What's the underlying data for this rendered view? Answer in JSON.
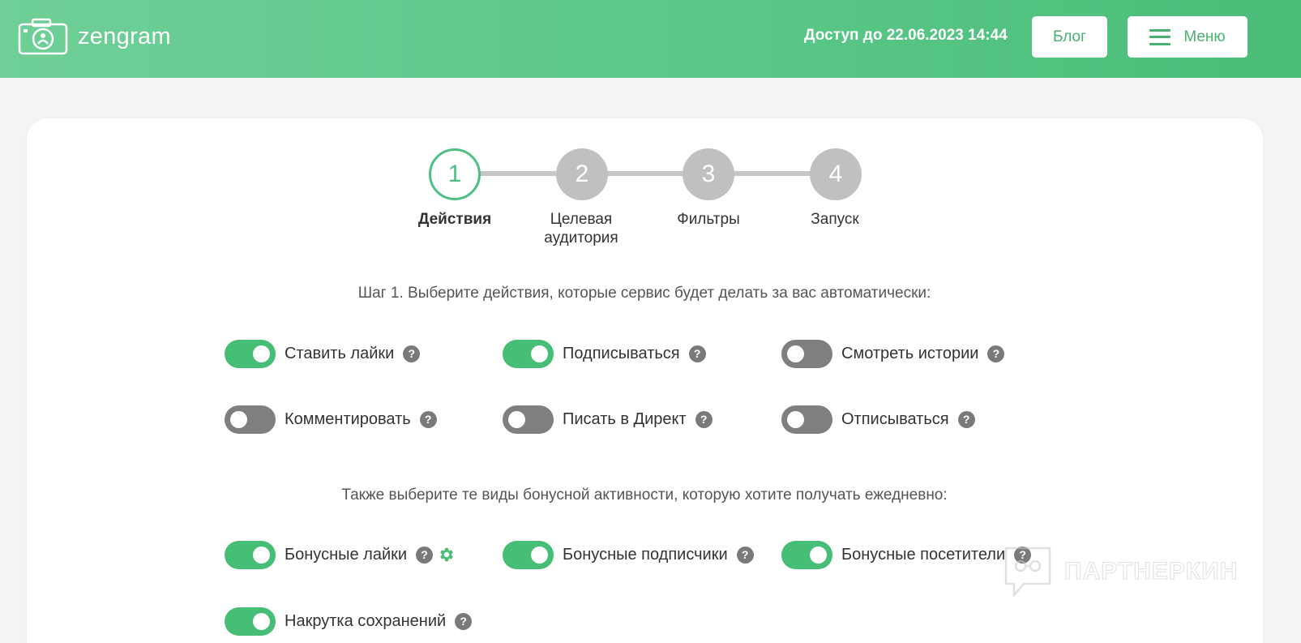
{
  "header": {
    "logo_text": "zengram",
    "access_text": "Доступ до 22.06.2023 14:44",
    "blog_label": "Блог",
    "menu_label": "Меню"
  },
  "stepper": {
    "steps": [
      {
        "number": "1",
        "label": "Действия",
        "active": true
      },
      {
        "number": "2",
        "label_line1": "Целевая",
        "label_line2": "аудитория",
        "active": false
      },
      {
        "number": "3",
        "label": "Фильтры",
        "active": false
      },
      {
        "number": "4",
        "label": "Запуск",
        "active": false
      }
    ]
  },
  "step1": {
    "instruction": "Шаг 1. Выберите действия, которые сервис будет делать за вас автоматически:",
    "actions": [
      {
        "label": "Ставить лайки",
        "enabled": true
      },
      {
        "label": "Подписываться",
        "enabled": true
      },
      {
        "label": "Смотреть истории",
        "enabled": false
      },
      {
        "label": "Комментировать",
        "enabled": false
      },
      {
        "label": "Писать в Директ",
        "enabled": false
      },
      {
        "label": "Отписываться",
        "enabled": false
      }
    ],
    "bonus_instruction": "Также выберите те виды бонусной активности, которую хотите получать ежедневно:",
    "bonus": [
      {
        "label": "Бонусные лайки",
        "enabled": true,
        "has_settings": true
      },
      {
        "label": "Бонусные подписчики",
        "enabled": true
      },
      {
        "label": "Бонусные посетители",
        "enabled": true
      },
      {
        "label": "Накрутка сохранений",
        "enabled": true
      }
    ],
    "help_symbol": "?"
  },
  "watermark": {
    "text": "ПАРТНЕРКИН"
  },
  "colors": {
    "header_start": "#6fcf97",
    "header_end": "#4bbd78",
    "accent": "#4fc083",
    "toggle_on": "#46be76",
    "toggle_off": "#7f7f7f",
    "step_inactive": "#c0c0c0"
  }
}
